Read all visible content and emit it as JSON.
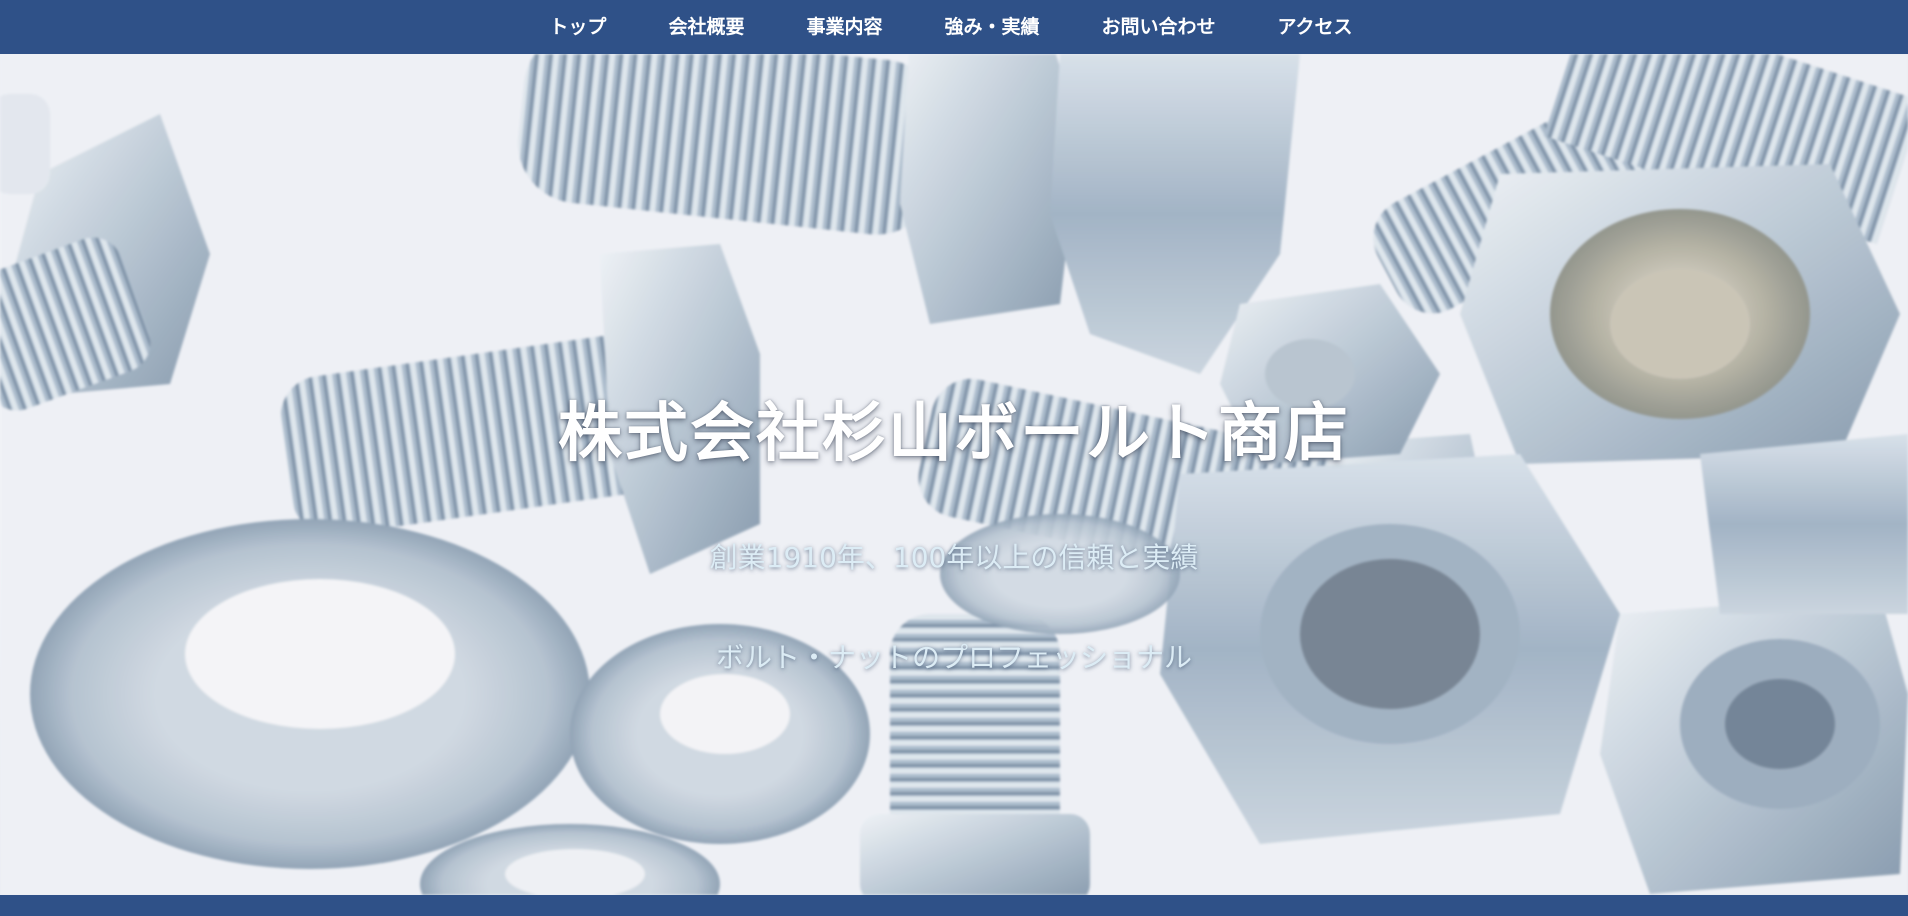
{
  "nav": {
    "items": [
      {
        "label": "トップ"
      },
      {
        "label": "会社概要"
      },
      {
        "label": "事業内容"
      },
      {
        "label": "強み・実績"
      },
      {
        "label": "お問い合わせ"
      },
      {
        "label": "アクセス"
      }
    ]
  },
  "hero": {
    "title": "株式会社杉山ボールト商店",
    "subtitle_1": "創業1910年、100年以上の信頼と実績",
    "subtitle_2": "ボルト・ナットのプロフェッショナル",
    "image_subject": "bolts-nuts-washers-photo"
  },
  "colors": {
    "nav_background": "#2f5188",
    "nav_text": "#ffffff",
    "title_text": "#ffffff",
    "subtitle_text": "#dcecf5",
    "metal_light": "#dfe6ee",
    "metal_mid": "#a9b8c8",
    "metal_dark": "#7f92a6"
  }
}
